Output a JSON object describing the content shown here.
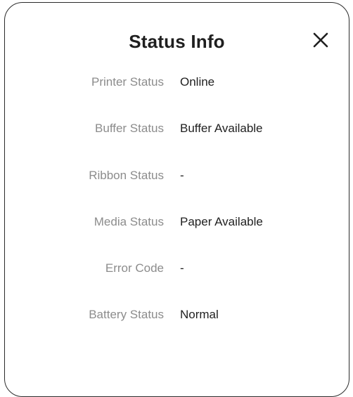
{
  "dialog": {
    "title": "Status Info",
    "close_icon": "close-icon"
  },
  "rows": [
    {
      "label": "Printer Status",
      "value": "Online"
    },
    {
      "label": "Buffer Status",
      "value": "Buffer Available"
    },
    {
      "label": "Ribbon Status",
      "value": "-"
    },
    {
      "label": "Media Status",
      "value": "Paper Available"
    },
    {
      "label": "Error Code",
      "value": "-"
    },
    {
      "label": "Battery Status",
      "value": "Normal"
    }
  ]
}
